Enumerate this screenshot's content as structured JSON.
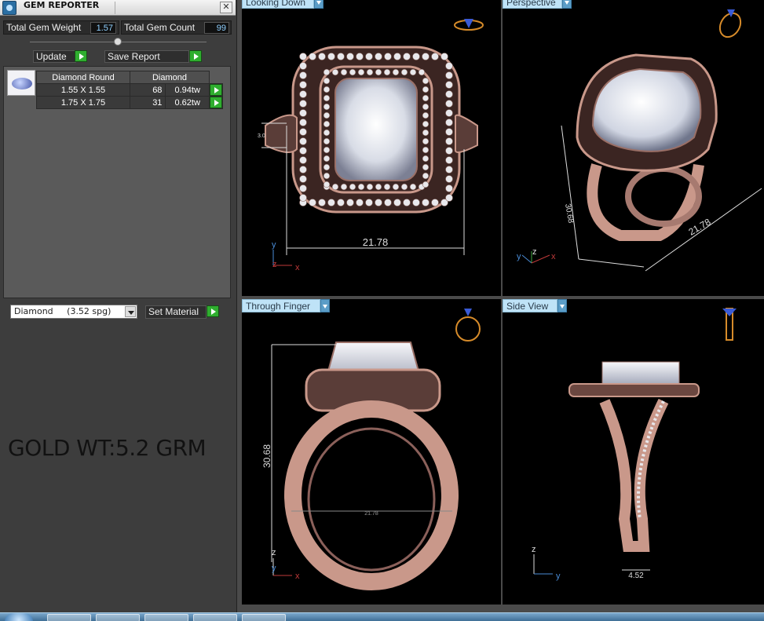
{
  "window": {
    "title": "GEM REPORTER",
    "close_label": "✕"
  },
  "summary": {
    "weight_label": "Total Gem Weight",
    "weight_value": "1.57",
    "count_label": "Total Gem Count",
    "count_value": "99"
  },
  "actions": {
    "update_label": "Update",
    "save_report_label": "Save Report",
    "set_material_label": "Set Material"
  },
  "gem_table": {
    "headers": [
      "Diamond Round",
      "Diamond"
    ],
    "rows": [
      {
        "size": "1.55 X 1.55",
        "count": "68",
        "weight": "0.94tw"
      },
      {
        "size": "1.75 X 1.75",
        "count": "31",
        "weight": "0.62tw"
      }
    ]
  },
  "material": {
    "selected": "Diamond     (3.52 spg)"
  },
  "note": {
    "gold_weight": "GOLD WT:5.2 GRM"
  },
  "viewports": {
    "top_left": {
      "title": "Looking Down",
      "dimension": "21.78",
      "small_dimension": "3.0",
      "axes": [
        "y",
        "z",
        "x"
      ]
    },
    "top_right": {
      "title": "Perspective",
      "dimension_a": "21.78",
      "dimension_b": "30.68",
      "axes": [
        "y",
        "z",
        "x"
      ]
    },
    "bottom_left": {
      "title": "Through Finger",
      "dimension": "30.68",
      "small_dimension": "21.78",
      "axes": [
        "z",
        "y",
        "x"
      ]
    },
    "bottom_right": {
      "title": "Side View",
      "dimension": "4.52",
      "axes": [
        "z",
        "y"
      ]
    }
  },
  "colors": {
    "metal": "#c9988a",
    "metal_dark": "#6b4740",
    "tab_bg": "#bfe3f7",
    "go_green": "#2fae2f",
    "ortho_icon": "#d68b2a"
  },
  "icons": {
    "close": "close-icon",
    "go": "play-arrow-icon",
    "dropdown": "chevron-down-icon",
    "ring_orientation": "ring-orientation-icon"
  }
}
